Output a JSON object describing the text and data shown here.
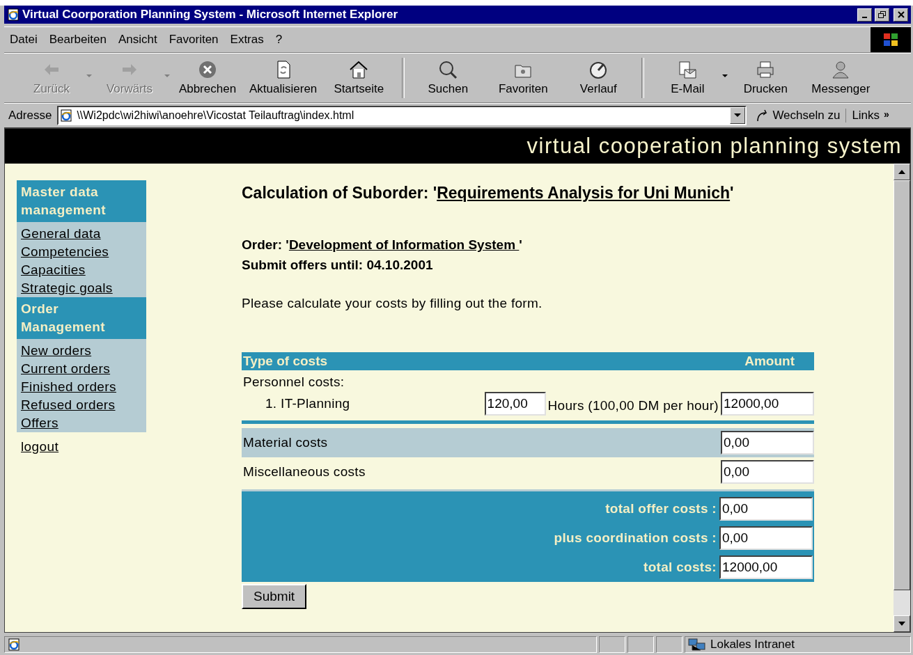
{
  "window": {
    "title": "Virtual Coorporation Planning System - Microsoft Internet Explorer"
  },
  "menu": [
    {
      "label": "Datei"
    },
    {
      "label": "Bearbeiten"
    },
    {
      "label": "Ansicht"
    },
    {
      "label": "Favoriten"
    },
    {
      "label": "Extras"
    },
    {
      "label": "?"
    }
  ],
  "toolbar": [
    {
      "label": "Zurück",
      "disabled": true,
      "dropdown": true,
      "separator_after": false
    },
    {
      "label": "Vorwärts",
      "disabled": true,
      "dropdown": true,
      "separator_after": false
    },
    {
      "label": "Abbrechen",
      "disabled": false,
      "dropdown": false,
      "separator_after": false
    },
    {
      "label": "Aktualisieren",
      "disabled": false,
      "dropdown": false,
      "separator_after": false
    },
    {
      "label": "Startseite",
      "disabled": false,
      "dropdown": false,
      "separator_after": true
    },
    {
      "label": "Suchen",
      "disabled": false,
      "dropdown": false,
      "separator_after": false
    },
    {
      "label": "Favoriten",
      "disabled": false,
      "dropdown": false,
      "separator_after": false
    },
    {
      "label": "Verlauf",
      "disabled": false,
      "dropdown": false,
      "separator_after": true
    },
    {
      "label": "E-Mail",
      "disabled": false,
      "dropdown": true,
      "separator_after": false
    },
    {
      "label": "Drucken",
      "disabled": false,
      "dropdown": false,
      "separator_after": false
    },
    {
      "label": "Messenger",
      "disabled": false,
      "dropdown": false,
      "separator_after": false
    }
  ],
  "address_bar": {
    "label": "Adresse",
    "value": "\\\\Wi2pdc\\wi2hiwi\\anoehre\\Vicostat Teilauftrag\\index.html",
    "go": "Wechseln zu",
    "links": "Links",
    "more": "»"
  },
  "banner": {
    "title": "virtual cooperation planning system"
  },
  "sidebar": {
    "sections": [
      {
        "title": "Master data management",
        "items": [
          "General data",
          "Competencies",
          "Capacities",
          "Strategic goals"
        ]
      },
      {
        "title": "Order Management",
        "items": [
          "New orders",
          "Current orders",
          "Finished orders",
          "Refused orders",
          "Offers"
        ]
      }
    ],
    "logout": "logout"
  },
  "main": {
    "heading": {
      "prefix": "Calculation of Suborder: '",
      "link": "Requirements Analysis for Uni Munich",
      "suffix": "'"
    },
    "order": {
      "label": "Order: '",
      "link": "Development of Information System ",
      "suffix": "'"
    },
    "deadline": "Submit offers until: 04.10.2001",
    "instruction": "Please calculate your costs by filling out the form.",
    "table": {
      "columns": [
        "Type of costs",
        "Amount"
      ],
      "personnel_label": "Personnel costs:",
      "personnel": [
        {
          "number": "1.",
          "name": "IT-Planning",
          "hours": "120,00",
          "rate": "Hours (100,00 DM per hour)",
          "amount": "12000,00"
        }
      ],
      "rows": [
        {
          "label": "Material costs",
          "value": "0,00",
          "shaded": true
        },
        {
          "label": "Miscellaneous costs",
          "value": "0,00",
          "shaded": false
        }
      ],
      "totals": [
        {
          "label": "total offer costs :",
          "value": "0,00"
        },
        {
          "label": "plus coordination costs :",
          "value": "0,00"
        },
        {
          "label": "total costs:",
          "value": "12000,00"
        }
      ]
    },
    "submit": "Submit"
  },
  "status_bar": {
    "zone": "Lokales Intranet"
  }
}
